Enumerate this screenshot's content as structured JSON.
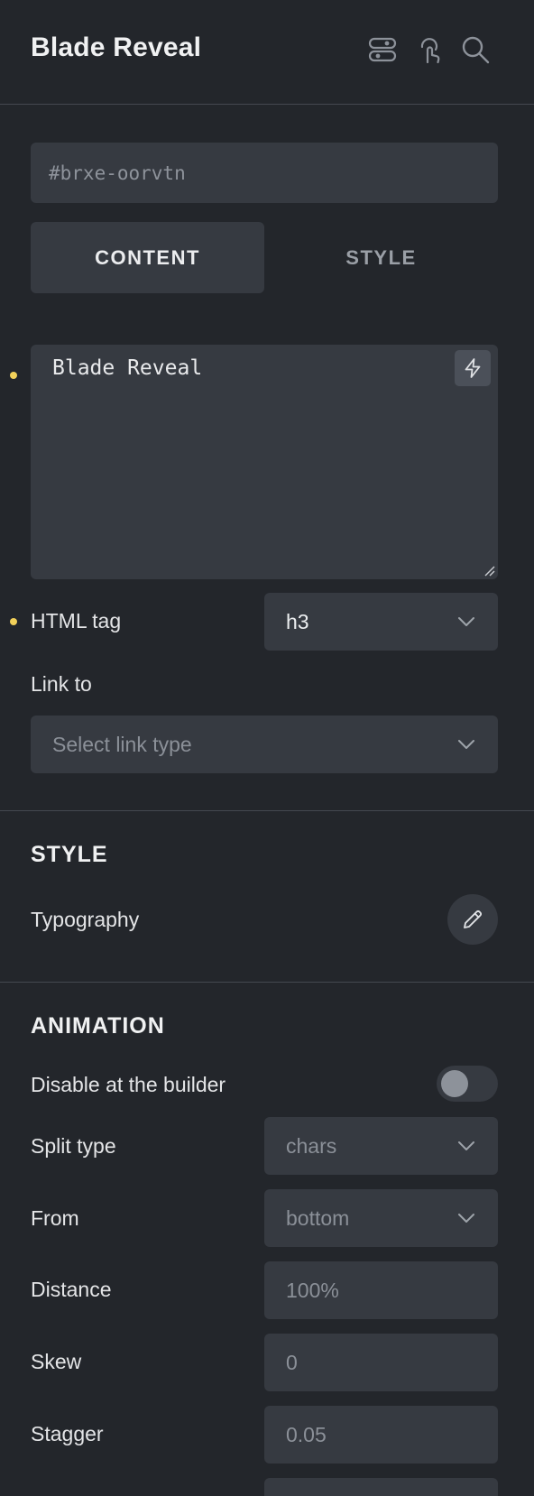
{
  "header": {
    "title": "Blade Reveal",
    "icons": [
      "toggles-icon",
      "interaction-icon",
      "search-icon"
    ]
  },
  "element": {
    "id_placeholder": "#brxe-oorvtn"
  },
  "tabs": [
    {
      "label": "CONTENT",
      "active": true
    },
    {
      "label": "STYLE",
      "active": false
    }
  ],
  "content": {
    "text_value": "Blade Reveal",
    "html_tag": {
      "label": "HTML tag",
      "value": "h3"
    },
    "link_to": {
      "label": "Link to",
      "placeholder": "Select link type"
    }
  },
  "style_section": {
    "title": "STYLE",
    "typography_label": "Typography"
  },
  "animation_section": {
    "title": "ANIMATION",
    "disable_label": "Disable at the builder",
    "disable_enabled": false,
    "split_type": {
      "label": "Split type",
      "value": "chars"
    },
    "from": {
      "label": "From",
      "value": "bottom"
    },
    "distance": {
      "label": "Distance",
      "placeholder": "100%"
    },
    "skew": {
      "label": "Skew",
      "placeholder": "0"
    },
    "stagger": {
      "label": "Stagger",
      "placeholder": "0.05"
    }
  },
  "colors": {
    "background": "#23262b",
    "field": "#363a41",
    "modified_dot": "#f2d15a"
  }
}
